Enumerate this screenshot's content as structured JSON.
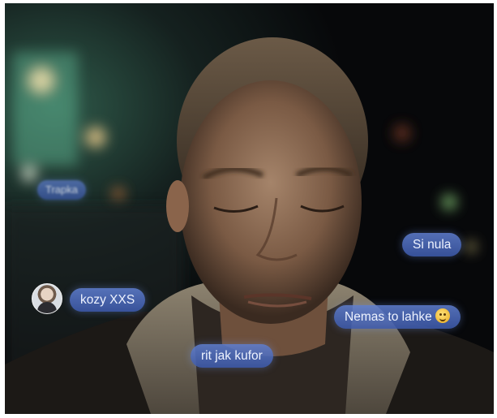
{
  "scene": {
    "description_colors": {
      "background": "#08090a",
      "bubble": "#4d6fc4",
      "text": "#eef3ff"
    }
  },
  "messages": [
    {
      "text": "Trapka",
      "blurred": true
    },
    {
      "text": "Si nula",
      "blurred": false
    },
    {
      "text": "kozy XXS",
      "blurred": false,
      "has_avatar": true
    },
    {
      "text": "Nemas to lahke",
      "blurred": false,
      "emoji": "smiling-face-emoji"
    },
    {
      "text": "rit jak kufor",
      "blurred": false
    }
  ]
}
